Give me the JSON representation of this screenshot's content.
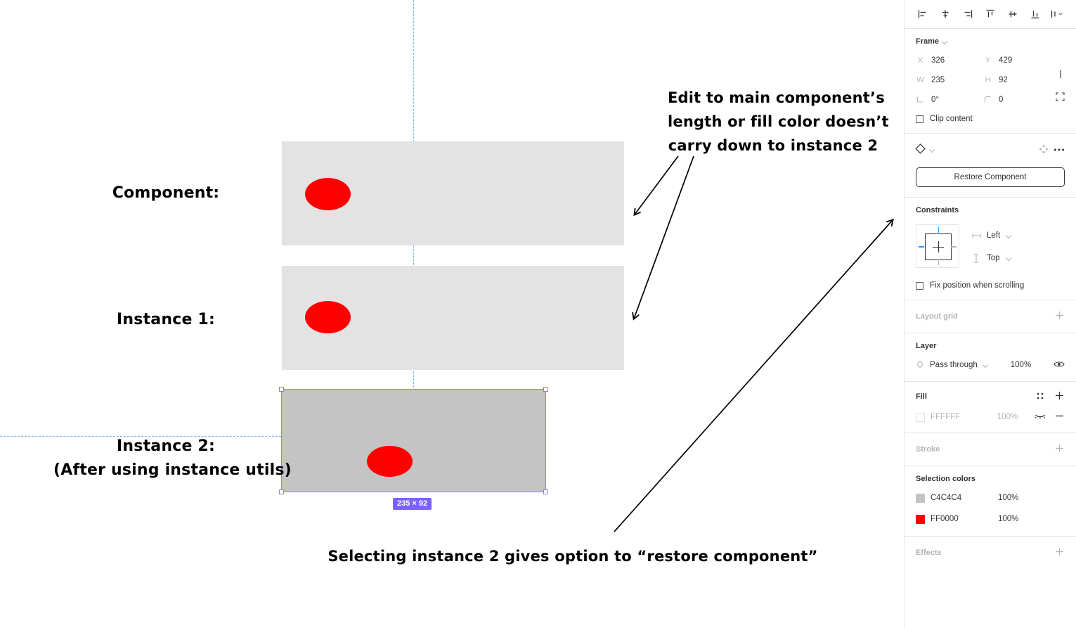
{
  "canvas": {
    "labels": {
      "component": "Component:",
      "instance1": "Instance 1:",
      "instance2_line1": "Instance 2:",
      "instance2_line2": "(After using instance utils)"
    },
    "annotation_note": "Edit to main component’s\nlength or fill color doesn’t\ncarry down to instance 2",
    "annotation_caption": "Selecting instance 2 gives option to “restore component”",
    "selection_size_badge": "235 × 92",
    "colors": {
      "frame_fill": "#E3E3E3",
      "instance2_fill": "#C4C4C4",
      "ellipse_fill": "#FF0000",
      "selection_stroke": "#8B7EF0",
      "badge_bg": "#7B61FF",
      "guide": "#6CB4F0"
    }
  },
  "panel": {
    "align_buttons": [
      {
        "name": "align-left",
        "label": "Align left"
      },
      {
        "name": "align-horizontal-centers",
        "label": "Align horizontal centers"
      },
      {
        "name": "align-right",
        "label": "Align right"
      },
      {
        "name": "align-top",
        "label": "Align top"
      },
      {
        "name": "align-vertical-centers",
        "label": "Align vertical centers"
      },
      {
        "name": "align-bottom",
        "label": "Align bottom"
      },
      {
        "name": "distribute-more",
        "label": "More align options"
      }
    ],
    "frame": {
      "title": "Frame",
      "x_label": "X",
      "x_value": "326",
      "y_label": "Y",
      "y_value": "429",
      "w_label": "W",
      "w_value": "235",
      "h_label": "H",
      "h_value": "92",
      "rotation_label": "",
      "rotation_value": "0°",
      "corner_label": "",
      "corner_value": "0",
      "clip_content": "Clip content"
    },
    "component": {
      "restore_label": "Restore Component"
    },
    "constraints": {
      "title": "Constraints",
      "horizontal": "Left",
      "vertical": "Top",
      "fix_position": "Fix position when scrolling"
    },
    "layout_grid": {
      "title": "Layout grid"
    },
    "layer": {
      "title": "Layer",
      "blend_mode": "Pass through",
      "opacity": "100%"
    },
    "fill": {
      "title": "Fill",
      "hex": "FFFFFF",
      "opacity": "100%"
    },
    "stroke": {
      "title": "Stroke"
    },
    "selection_colors": {
      "title": "Selection colors",
      "items": [
        {
          "hex": "C4C4C4",
          "opacity": "100%",
          "color": "#C4C4C4"
        },
        {
          "hex": "FF0000",
          "opacity": "100%",
          "color": "#FF0000"
        }
      ]
    },
    "effects": {
      "title": "Effects"
    }
  }
}
